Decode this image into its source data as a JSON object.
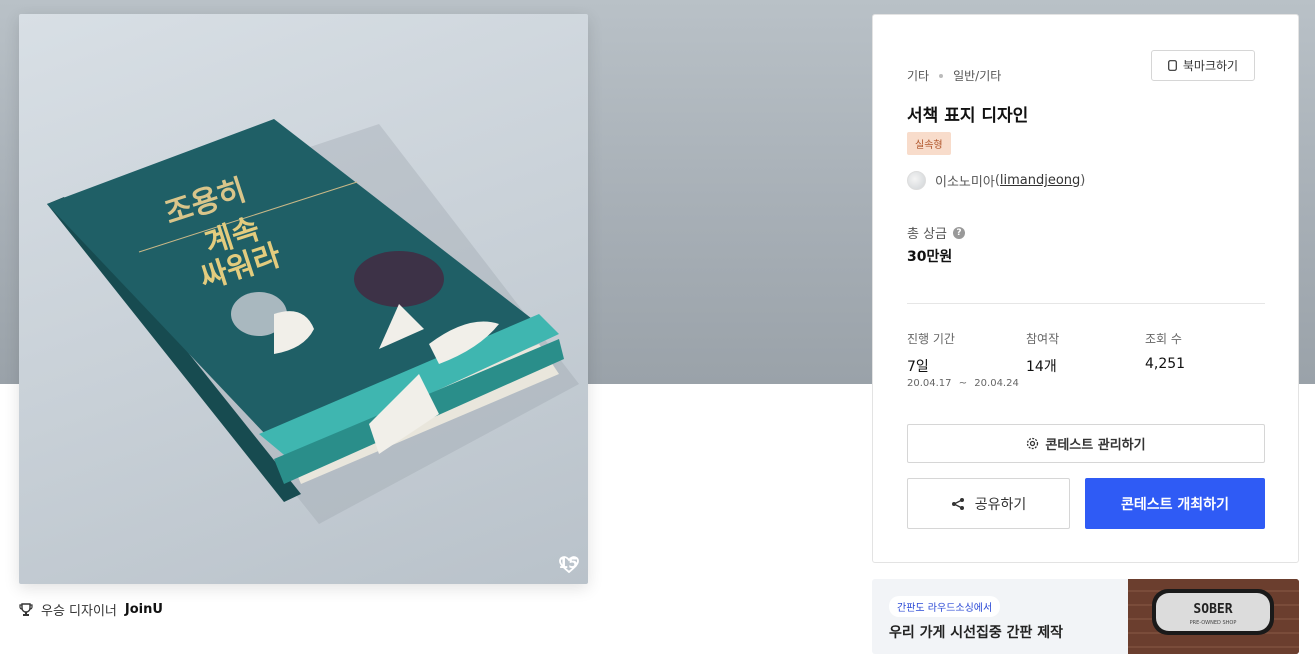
{
  "hero": {
    "book_title_lines": [
      "조용히",
      "계속",
      "싸워라"
    ],
    "likes": "15"
  },
  "winner": {
    "prefix": "우승 디자이너",
    "name": "JoinU"
  },
  "panel": {
    "category": "기타",
    "subcategory": "일반/기타",
    "bookmark_label": "북마크하기",
    "title": "서책 표지 디자인",
    "badge": "실속형",
    "host_name": "이소노미아",
    "host_id": "limandjeong",
    "prize_label": "총 상금",
    "prize_value": "30만원",
    "stats": [
      {
        "label": "진행 기간",
        "value": "7일"
      },
      {
        "label": "참여작",
        "value": "14개"
      },
      {
        "label": "조회 수",
        "value": "4,251"
      }
    ],
    "period_start": "20.04.17",
    "period_sep": "~",
    "period_end": "20.04.24",
    "manage_label": "콘테스트 관리하기",
    "share_label": "공유하기",
    "host_button_label": "콘테스트 개최하기"
  },
  "ad": {
    "chip": "간판도 라우드소싱에서",
    "text": "우리 가게 시선집중 간판 제작",
    "sign_text": "SOBER",
    "sign_sub": "PRE-OWNED SHOP"
  },
  "colors": {
    "accent": "#2f5bf5",
    "badge_bg": "#f8dccb",
    "book_teal": "#1f5f66"
  }
}
